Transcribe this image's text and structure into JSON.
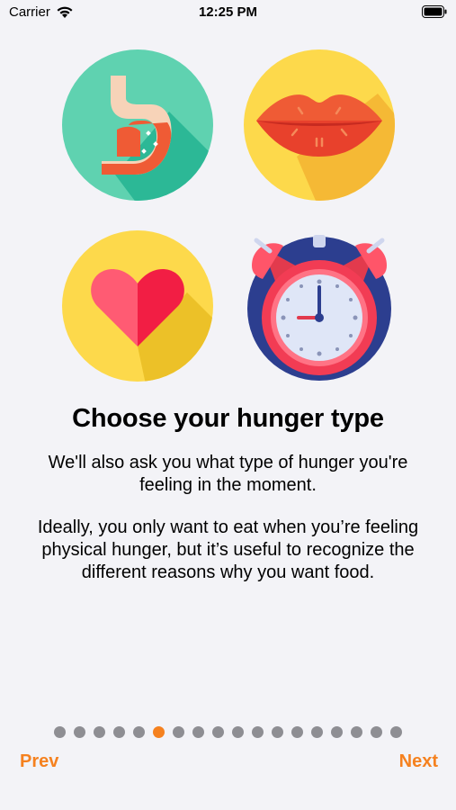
{
  "status_bar": {
    "carrier": "Carrier",
    "time": "12:25 PM",
    "icons": [
      "wifi-icon",
      "battery-icon"
    ]
  },
  "illustrations": [
    {
      "name": "stomach-icon"
    },
    {
      "name": "lips-icon"
    },
    {
      "name": "heart-icon"
    },
    {
      "name": "alarm-clock-icon"
    }
  ],
  "content": {
    "title": "Choose your hunger type",
    "paragraph_1": "We'll also ask you what type of hunger you're feeling in the moment.",
    "paragraph_2": "Ideally, you only want to eat when you’re feeling physical hunger, but it’s useful to recognize the different reasons why you want food."
  },
  "pagination": {
    "total_pages": 18,
    "current_page": 6
  },
  "navigation": {
    "prev_label": "Prev",
    "next_label": "Next"
  },
  "colors": {
    "accent": "#f5811f",
    "dot_inactive": "#8e8e93",
    "background": "#f3f3f7"
  }
}
